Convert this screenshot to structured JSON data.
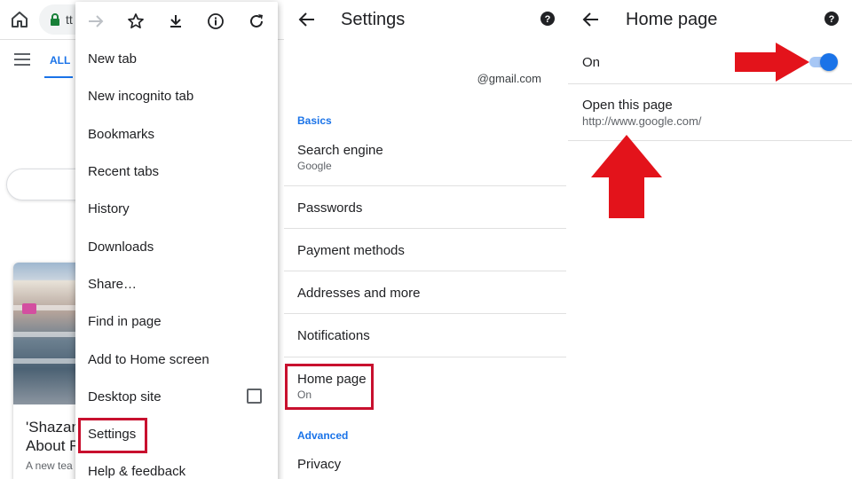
{
  "browser": {
    "url_fragment": "tt"
  },
  "page": {
    "tab_all": "ALL",
    "card_title_lines": [
      "'Shazam",
      "About R"
    ],
    "card_sub": "A new tea"
  },
  "menu": {
    "icons": [
      "forward-icon",
      "star-icon",
      "download-icon",
      "info-icon",
      "refresh-icon"
    ],
    "items": [
      {
        "label": "New tab"
      },
      {
        "label": "New incognito tab"
      },
      {
        "label": "Bookmarks"
      },
      {
        "label": "Recent tabs"
      },
      {
        "label": "History"
      },
      {
        "label": "Downloads"
      },
      {
        "label": "Share…"
      },
      {
        "label": "Find in page"
      },
      {
        "label": "Add to Home screen"
      },
      {
        "label": "Desktop site"
      },
      {
        "label": "Settings"
      },
      {
        "label": "Help & feedback"
      }
    ]
  },
  "settings": {
    "title": "Settings",
    "email": "@gmail.com",
    "basics_label": "Basics",
    "search_engine": {
      "title": "Search engine",
      "value": "Google"
    },
    "passwords": "Passwords",
    "payment_methods": "Payment methods",
    "addresses": "Addresses and more",
    "notifications": "Notifications",
    "home_page": {
      "title": "Home page",
      "value": "On"
    },
    "advanced_label": "Advanced",
    "privacy": "Privacy"
  },
  "home_page": {
    "title": "Home page",
    "toggle_label": "On",
    "toggle_on": true,
    "open_title": "Open this page",
    "open_url": "http://www.google.com/"
  },
  "colors": {
    "accent": "#1a73e8",
    "highlight_box": "#c8102e",
    "annotation_arrow": "#e3131b"
  }
}
